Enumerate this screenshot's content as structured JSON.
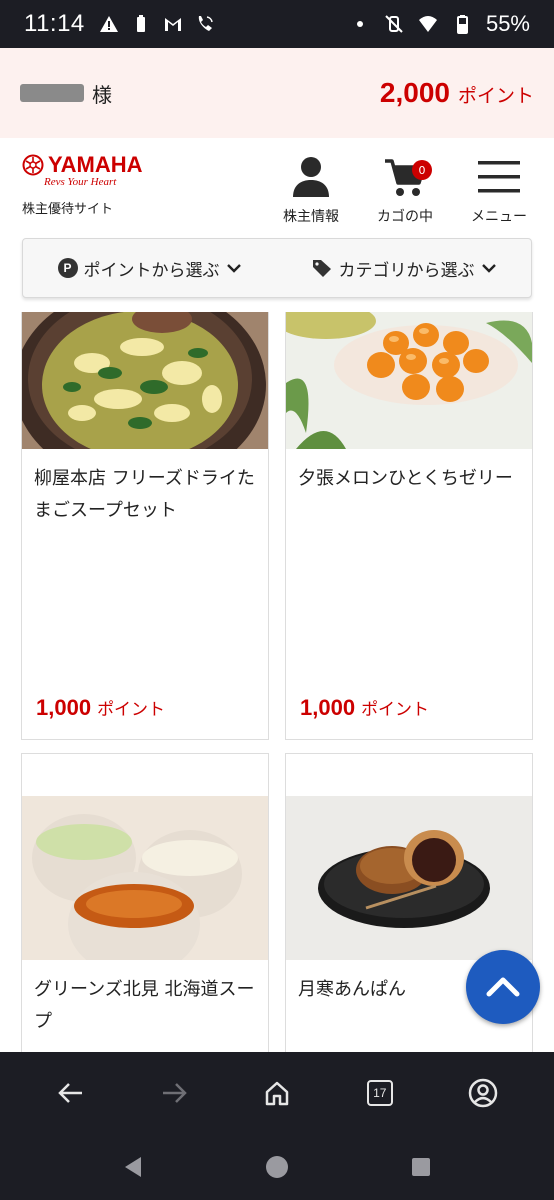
{
  "status_bar": {
    "time": "11:14",
    "battery": "55%",
    "icons": [
      "warning-icon",
      "battery-saver-icon",
      "gmail-icon",
      "phone-wifi-icon",
      "dot-icon",
      "mute-icon",
      "wifi-icon",
      "battery-icon"
    ]
  },
  "points_bar": {
    "user_suffix": "様",
    "points_value": "2,000",
    "points_unit": "ポイント"
  },
  "header": {
    "brand_name": "YAMAHA",
    "brand_tagline": "Revs Your Heart",
    "site_label": "株主優待サイト",
    "nav": [
      {
        "label": "株主情報",
        "icon": "user-icon"
      },
      {
        "label": "カゴの中",
        "icon": "cart-icon",
        "badge": "0"
      },
      {
        "label": "メニュー",
        "icon": "hamburger-icon"
      }
    ]
  },
  "filters": {
    "by_points": "ポイントから選ぶ",
    "by_category": "カテゴリから選ぶ",
    "points_badge": "P"
  },
  "products": [
    {
      "name": "柳屋本店 フリーズドライたまごスープセット",
      "price": "1,000",
      "unit": "ポイント"
    },
    {
      "name": "夕張メロンひとくちゼリー",
      "price": "1,000",
      "unit": "ポイント"
    },
    {
      "name": "グリーンズ北見 北海道スープ",
      "price": "",
      "unit": ""
    },
    {
      "name": "月寒あんぱん",
      "price": "",
      "unit": ""
    }
  ],
  "browser_bar": {
    "tab_count": "17"
  },
  "colors": {
    "brand_red": "#cc0000",
    "dark_bar": "#1c1d24",
    "scroll_button": "#1e5bbf",
    "points_bg": "#fdf1ef"
  }
}
